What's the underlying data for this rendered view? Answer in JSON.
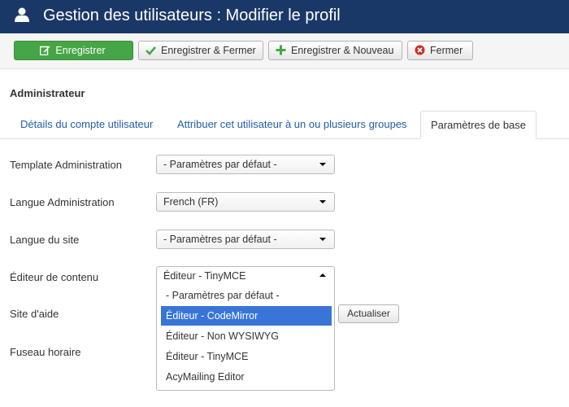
{
  "header": {
    "title": "Gestion des utilisateurs : Modifier le profil",
    "icon": "user-icon"
  },
  "toolbar": {
    "save_label": "Enregistrer",
    "save_close_label": "Enregistrer & Fermer",
    "save_new_label": "Enregistrer & Nouveau",
    "close_label": "Fermer",
    "save_color": "#46a546",
    "check_color": "#46a546",
    "close_color": "#c9302c"
  },
  "section": {
    "title": "Administrateur"
  },
  "tabs": [
    {
      "label": "Détails du compte utilisateur",
      "active": false
    },
    {
      "label": "Attribuer cet utilisateur à un ou plusieurs groupes",
      "active": false
    },
    {
      "label": "Paramètres de base",
      "active": true
    }
  ],
  "form": {
    "admin_template": {
      "label": "Template Administration",
      "value": "- Paramètres par défaut -"
    },
    "admin_language": {
      "label": "Langue Administration",
      "value": "French (FR)"
    },
    "site_language": {
      "label": "Langue du site",
      "value": "- Paramètres par défaut -"
    },
    "editor": {
      "label": "Éditeur de contenu",
      "value": "Éditeur - TinyMCE",
      "options": [
        "- Paramètres par défaut -",
        "Éditeur - CodeMirror",
        "Éditeur - Non WYSIWYG",
        "Éditeur - TinyMCE",
        "AcyMailing Editor"
      ],
      "highlighted_index": 1,
      "highlight_color": "#3875d7"
    },
    "help_site": {
      "label": "Site d'aide",
      "refresh_label": "Actualiser"
    },
    "timezone": {
      "label": "Fuseau horaire"
    }
  },
  "colors": {
    "header_bg": "#1a3867",
    "link": "#1f5ea8"
  }
}
